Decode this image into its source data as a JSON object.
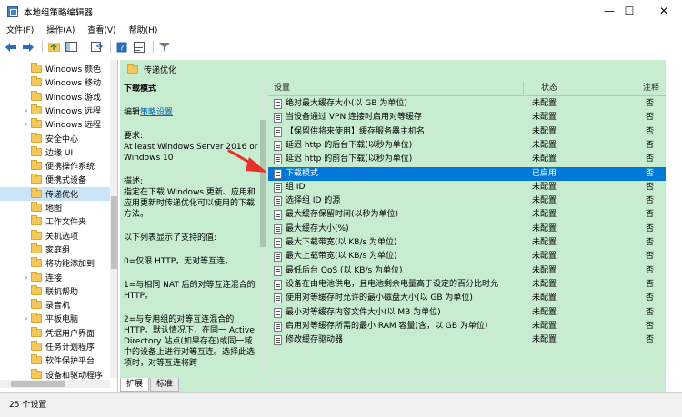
{
  "window": {
    "title": "本地组策略编辑器",
    "minimize": "—",
    "maximize": "☐",
    "close": "✕"
  },
  "menu": [
    "文件(F)",
    "操作(A)",
    "查看(V)",
    "帮助(H)"
  ],
  "toolbar": {
    "icons": [
      "back-icon",
      "forward-icon",
      "up-folder-icon",
      "show-hide-tree-icon",
      "export-icon",
      "help-icon",
      "properties-icon",
      "filter-icon"
    ]
  },
  "tree": {
    "items": [
      {
        "label": "Windows 颜色",
        "expandable": false
      },
      {
        "label": "Windows 移动",
        "expandable": false
      },
      {
        "label": "Windows 游戏",
        "expandable": false
      },
      {
        "label": "Windows 远程",
        "expandable": true
      },
      {
        "label": "Windows 远程",
        "expandable": true
      },
      {
        "label": "安全中心",
        "expandable": false
      },
      {
        "label": "边缘 UI",
        "expandable": false
      },
      {
        "label": "便携操作系统",
        "expandable": false
      },
      {
        "label": "便携式设备",
        "expandable": false
      },
      {
        "label": "传递优化",
        "expandable": false,
        "selected": true
      },
      {
        "label": "地图",
        "expandable": false
      },
      {
        "label": "工作文件夹",
        "expandable": false
      },
      {
        "label": "关机选项",
        "expandable": false
      },
      {
        "label": "家庭组",
        "expandable": false
      },
      {
        "label": "将功能添加到",
        "expandable": false
      },
      {
        "label": "连接",
        "expandable": true
      },
      {
        "label": "联机帮助",
        "expandable": false
      },
      {
        "label": "录音机",
        "expandable": false
      },
      {
        "label": "平板电脑",
        "expandable": true
      },
      {
        "label": "凭据用户界面",
        "expandable": false
      },
      {
        "label": "任务计划程序",
        "expandable": false
      },
      {
        "label": "软件保护平台",
        "expandable": false
      },
      {
        "label": "设备和驱动程序",
        "expandable": false
      }
    ]
  },
  "pane": {
    "title": "传递优化"
  },
  "description": {
    "title": "下载模式",
    "edit_prefix": "编辑",
    "edit_link": "策略设置",
    "req_label": "要求:",
    "req_text": "At least Windows Server 2016 or Windows 10",
    "desc_label": "描述:",
    "desc_text": "指定在下载 Windows 更新、应用和应用更新时传递优化可以使用的下载方法。",
    "list_intro": "以下列表显示了支持的值:",
    "value0": "0=仅限 HTTP，无对等互连。",
    "value1": "1=与相同 NAT 后的对等互连混合的 HTTP。",
    "value2": "2=与专用组的对等互连混合的 HTTP。默认情况下，在同一 Active Directory 站点(如果存在)或同一域中的设备上进行对等互连。选择此选项时，对等互连将跨"
  },
  "list": {
    "headers": {
      "setting": "设置",
      "state": "状态",
      "note": "注释"
    },
    "rows": [
      {
        "name": "绝对最大缓存大小(以 GB 为单位)",
        "state": "未配置",
        "note": "否"
      },
      {
        "name": "当设备通过 VPN 连接时启用对等缓存",
        "state": "未配置",
        "note": "否"
      },
      {
        "name": "【保留供将来使用】缓存服务器主机名",
        "state": "未配置",
        "note": "否"
      },
      {
        "name": "延迟 http 的后台下载(以秒为单位)",
        "state": "未配置",
        "note": "否"
      },
      {
        "name": "延迟 http 的前台下载(以秒为单位)",
        "state": "未配置",
        "note": "否"
      },
      {
        "name": "下载模式",
        "state": "已启用",
        "note": "否",
        "selected": true
      },
      {
        "name": "组 ID",
        "state": "未配置",
        "note": "否"
      },
      {
        "name": "选择组 ID 的源",
        "state": "未配置",
        "note": "否"
      },
      {
        "name": "最大缓存保留时间(以秒为单位)",
        "state": "未配置",
        "note": "否"
      },
      {
        "name": "最大缓存大小(%)",
        "state": "未配置",
        "note": "否"
      },
      {
        "name": "最大下载带宽(以 KB/s 为单位)",
        "state": "未配置",
        "note": "否"
      },
      {
        "name": "最大上载带宽(以 KB/s 为单位)",
        "state": "未配置",
        "note": "否"
      },
      {
        "name": "最低后台 QoS (以 KB/s 为单位)",
        "state": "未配置",
        "note": "否"
      },
      {
        "name": "设备在由电池供电，且电池剩余电量高于设定的百分比时允",
        "state": "未配置",
        "note": "否"
      },
      {
        "name": "使用对等缓存时允许的最小磁盘大小(以 GB 为单位)",
        "state": "未配置",
        "note": "否"
      },
      {
        "name": "最小对等缓存内容文件大小(以 MB 为单位)",
        "state": "未配置",
        "note": "否"
      },
      {
        "name": "启用对等缓存所需的最小 RAM 容量(含，以 GB 为单位)",
        "state": "未配置",
        "note": "否"
      },
      {
        "name": "修改缓存驱动器",
        "state": "未配置",
        "note": "否"
      }
    ]
  },
  "tabs": [
    {
      "label": "扩展",
      "active": true
    },
    {
      "label": "标准",
      "active": false
    }
  ],
  "status": {
    "text": "25 个设置"
  },
  "colors": {
    "pane_bg": "#c8ecd0",
    "selection": "#0078d7",
    "arrow": "#e8312a"
  }
}
